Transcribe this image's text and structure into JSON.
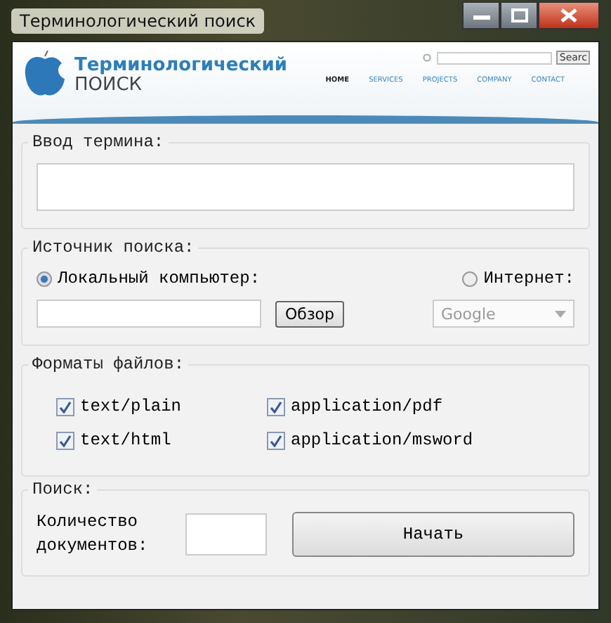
{
  "window": {
    "title": "Терминологический поиск"
  },
  "banner": {
    "logo_line1": "Терминологический",
    "logo_line2": "ПОИСК",
    "search_button": "Searc",
    "nav": [
      {
        "label": "HOME",
        "selected": true
      },
      {
        "label": "SERVICES",
        "selected": false
      },
      {
        "label": "PROJECTS",
        "selected": false
      },
      {
        "label": "COMPANY",
        "selected": false
      },
      {
        "label": "CONTACT",
        "selected": false
      }
    ]
  },
  "term_group": {
    "title": "Ввод термина:"
  },
  "source_group": {
    "title": "Источник поиска:",
    "options": [
      {
        "label": "Локальный компьютер:",
        "selected": true
      },
      {
        "label": "Интернет:",
        "selected": false
      }
    ],
    "browse_button": "Обзор",
    "engine": {
      "value": "Google",
      "disabled": true
    }
  },
  "formats_group": {
    "title": "Форматы файлов:",
    "formats": [
      {
        "label": "text/plain",
        "checked": true
      },
      {
        "label": "application/pdf",
        "checked": true
      },
      {
        "label": "text/html",
        "checked": true
      },
      {
        "label": "application/msword",
        "checked": true
      }
    ]
  },
  "search_group": {
    "title": "Поиск:",
    "count_label": "Количество документов:",
    "start_button": "Начать"
  }
}
